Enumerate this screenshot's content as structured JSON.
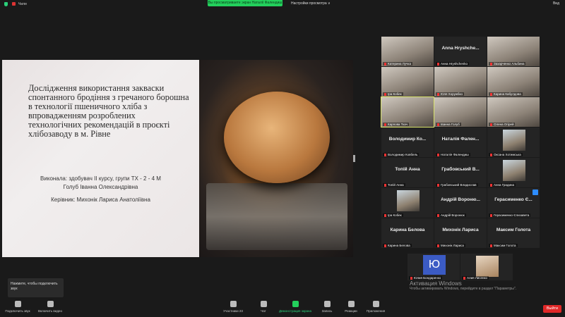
{
  "topbar": {
    "meeting_label": "Чили",
    "banner": "Вы просматриваете экран Наталії Фалендиш",
    "view_options": "Настройки просмотра ∨",
    "view_button": "Вид"
  },
  "slide": {
    "title": "Дослідження використання закваски спонтанного бродіння з гречаного борошна в технології пшеничного хліба з впровадженням розроблених технологічних рекомендацій в проєкті хлібозаводу в м. Рівне",
    "performer_line1": "Виконала: здобувач ІІ курсу, групи ТХ - 2 - 4 М",
    "performer_line2": "Голуб Іванна Олександрівна",
    "supervisor": "Керівник:   Михонік Лариса Анатоліївна"
  },
  "participants": [
    {
      "big": "",
      "name": "Катерина Лучка",
      "video": true
    },
    {
      "big": "Anna Hryshche...",
      "name": "Анна Hryshchenko",
      "video": false
    },
    {
      "big": "",
      "name": "Захарченко Альбина",
      "video": true
    },
    {
      "big": "",
      "name": "Іра Кобек",
      "video": true
    },
    {
      "big": "",
      "name": "Юля Хоружбко",
      "video": true
    },
    {
      "big": "",
      "name": "Карина Кабулдова",
      "video": true
    },
    {
      "big": "",
      "name": "Карпова Ткач",
      "video": true,
      "active": true
    },
    {
      "big": "",
      "name": "Іванна Голуб",
      "video": true
    },
    {
      "big": "",
      "name": "Олена Огірей",
      "video": true
    },
    {
      "big": "Володимир Ко...",
      "name": "Володимир Ковбель",
      "video": false
    },
    {
      "big": "Наталія Фален...",
      "name": "Наталія Фалендиш",
      "video": false
    },
    {
      "big": "",
      "name": "Оксана Хотимська",
      "photo": true
    },
    {
      "big": "Топій Анна",
      "name": "Топій Анна",
      "video": false
    },
    {
      "big": "Грабовський В...",
      "name": "Грабовський Владислав",
      "video": false
    },
    {
      "big": "",
      "name": "Анна Градина",
      "photo": true
    },
    {
      "big": "",
      "name": "Іра Кобек",
      "photo": true
    },
    {
      "big": "Андрій Вороню...",
      "name": "Андрій Воронюк",
      "video": false
    },
    {
      "big": "Герасименко Є...",
      "name": "Герасименко Єлизавета",
      "video": false,
      "badge": true
    },
    {
      "big": "Карина Белова",
      "name": "Карина Белова",
      "video": false
    },
    {
      "big": "Михонік Лариса",
      "name": "Михонік Лариса",
      "video": false
    },
    {
      "big": "Максим Голота",
      "name": "Максим Голота",
      "video": false
    }
  ],
  "bottom_tiles": [
    {
      "avatar": "Ю",
      "name": "Юлия Бондаренко"
    },
    {
      "avatar": "",
      "name": "Алия Лисенко"
    }
  ],
  "watermark": {
    "title": "Активация Windows",
    "subtitle": "Чтобы активировать Windows, перейдите в раздел \"Параметры\"."
  },
  "tooltip": "Нажмите, чтобы подключить звук",
  "toolbar": {
    "audio": "Подключить звук",
    "video": "Включить видео",
    "participants": "Участники",
    "participants_count": "23",
    "chat": "Чат",
    "share": "Демонстрация экрана",
    "record": "Запись",
    "reactions": "Реакции",
    "apps": "Приложения",
    "leave": "Выйти"
  }
}
